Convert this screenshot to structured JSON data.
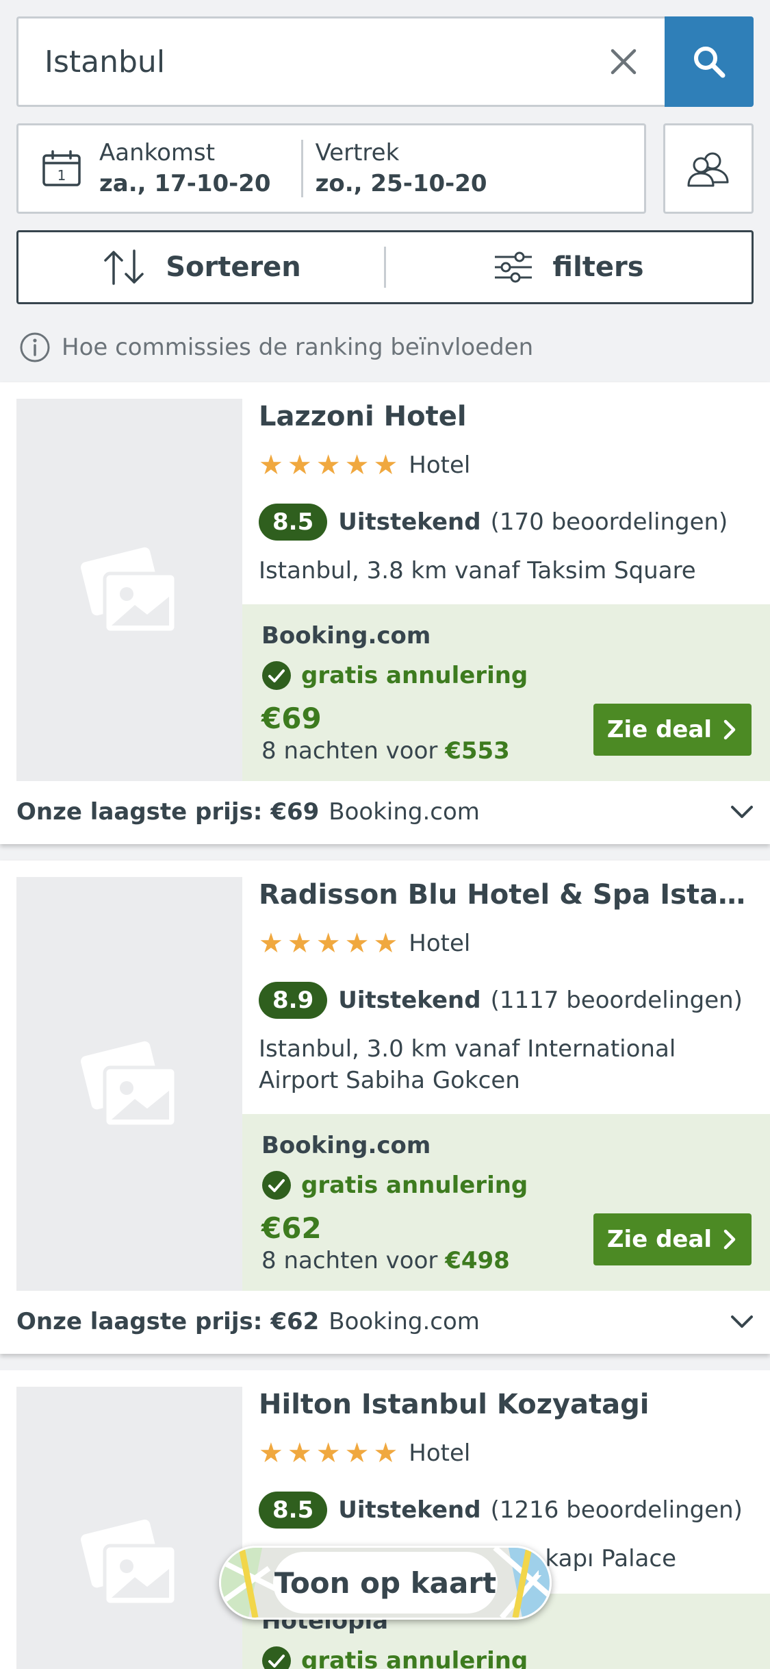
{
  "search": {
    "query": "Istanbul"
  },
  "dates": {
    "arrival_label": "Aankomst",
    "arrival_value": "za., 17-10-20",
    "departure_label": "Vertrek",
    "departure_value": "zo., 25-10-20"
  },
  "sort_filter": {
    "sort_label": "Sorteren",
    "filter_label": "filters"
  },
  "info": {
    "text": "Hoe commissies de ranking beïnvloeden"
  },
  "colors": {
    "search_button": "#2f7fb8",
    "rating_badge": "#2f5f1e",
    "deal_button": "#4c8a24",
    "deal_background": "#e8f0e1",
    "star": "#f0a83f"
  },
  "hotels": [
    {
      "name": "Lazzoni Hotel",
      "stars": 5,
      "type": "Hotel",
      "rating": "8.5",
      "rating_word": "Uitstekend",
      "reviews": "(170 beoordelingen)",
      "location": "Istanbul, 3.8 km vanaf Taksim Square",
      "provider": "Booking.com",
      "free_cancel": "gratis annulering",
      "price": "€69",
      "nights_text": "8 nachten voor",
      "total": "€553",
      "deal_label": "Zie deal",
      "lowest_label": "Onze laagste prijs:",
      "lowest_price": "€69",
      "lowest_provider": "Booking.com"
    },
    {
      "name": "Radisson Blu Hotel & Spa Istanbul ...",
      "stars": 5,
      "type": "Hotel",
      "rating": "8.9",
      "rating_word": "Uitstekend",
      "reviews": "(1117 beoordelingen)",
      "location": "Istanbul, 3.0 km vanaf International Airport Sabiha Gokcen",
      "provider": "Booking.com",
      "free_cancel": "gratis annulering",
      "price": "€62",
      "nights_text": "8 nachten voor",
      "total": "€498",
      "deal_label": "Zie deal",
      "lowest_label": "Onze laagste prijs:",
      "lowest_price": "€62",
      "lowest_provider": "Booking.com"
    },
    {
      "name": "Hilton Istanbul Kozyatagi",
      "stars": 5,
      "type": "Hotel",
      "rating": "8.5",
      "rating_word": "Uitstekend",
      "reviews": "(1216 beoordelingen)",
      "location_fragment": "kapı Palace",
      "provider": "Hotelopia",
      "free_cancel": "gratis annulering"
    }
  ],
  "map_button": {
    "label": "Toon op kaart"
  }
}
